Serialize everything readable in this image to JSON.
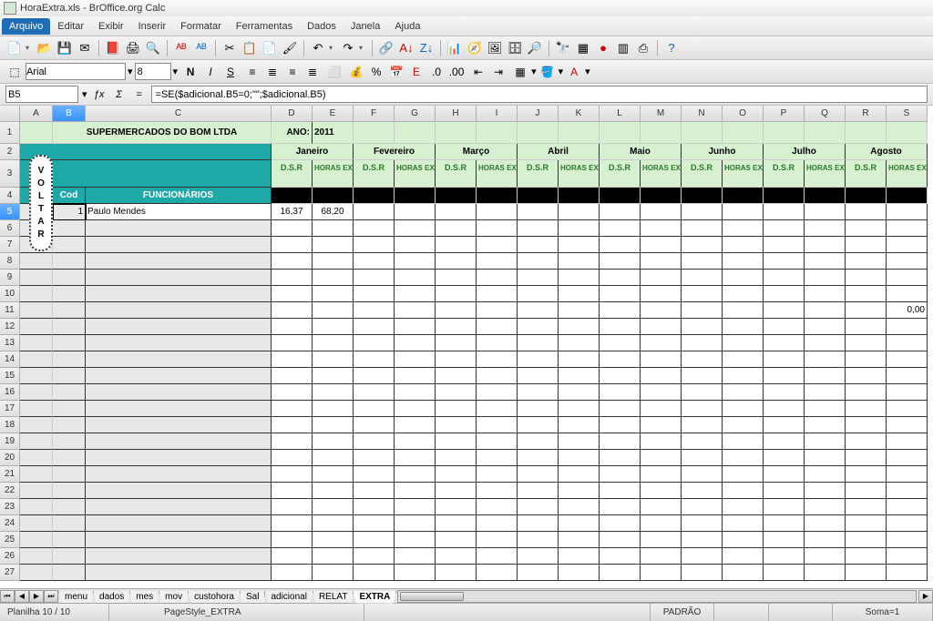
{
  "title": "HoraExtra.xls - BrOffice.org Calc",
  "menu": [
    "Arquivo",
    "Editar",
    "Exibir",
    "Inserir",
    "Formatar",
    "Ferramentas",
    "Dados",
    "Janela",
    "Ajuda"
  ],
  "font": {
    "name": "Arial",
    "size": "8"
  },
  "namebox": "B5",
  "formula": "=SE($adicional.B5=0;\"\";$adicional.B5)",
  "cols": [
    "",
    "A",
    "B",
    "C",
    "D",
    "E",
    "F",
    "G",
    "H",
    "I",
    "J",
    "K",
    "L",
    "M",
    "N",
    "O",
    "P",
    "Q",
    "R",
    "S"
  ],
  "sheet": {
    "company": "SUPERMERCADOS DO BOM LTDA",
    "ano_label": "ANO:",
    "ano": "2011",
    "months": [
      "Janeiro",
      "Fevereiro",
      "Março",
      "Abril",
      "Maio",
      "Junho",
      "Julho",
      "Agosto"
    ],
    "subcols": {
      "dsr": "D.S.R",
      "horas": "HORAS EXTRAS"
    },
    "cod_hdr": "Cod",
    "func_hdr": "FUNCIONÁRIOS",
    "row5": {
      "cod": "1",
      "nome": "Paulo Mendes",
      "d": "16,37",
      "e": "68,20"
    },
    "s11": "0,00"
  },
  "voltar": [
    "V",
    "O",
    "L",
    "T",
    "A",
    "R"
  ],
  "tabs": [
    "menu",
    "dados",
    "mes",
    "mov",
    "custohora",
    "Sal",
    "adicional",
    "RELAT",
    "EXTRA"
  ],
  "status": {
    "sheet": "Planilha 10 / 10",
    "style": "PageStyle_EXTRA",
    "mode": "PADRÃO",
    "sum": "Soma=1"
  }
}
